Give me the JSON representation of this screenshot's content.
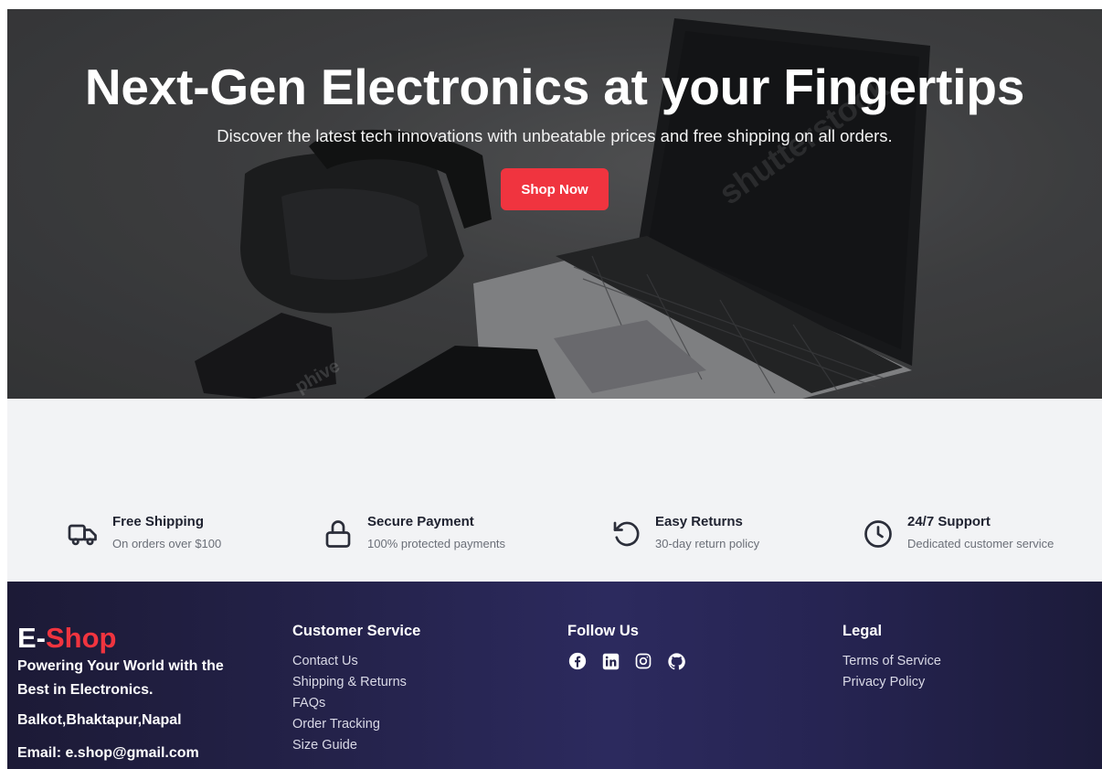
{
  "hero": {
    "title": "Next-Gen Electronics at your Fingertips",
    "subtitle": "Discover the latest tech innovations with unbeatable prices and free shipping on all orders.",
    "cta_label": "Shop Now",
    "watermarks": [
      "shutterstock",
      "phive"
    ]
  },
  "features": [
    {
      "icon": "truck-icon",
      "title": "Free Shipping",
      "desc": "On orders over $100"
    },
    {
      "icon": "lock-icon",
      "title": "Secure Payment",
      "desc": "100% protected payments"
    },
    {
      "icon": "rotate-ccw-icon",
      "title": "Easy Returns",
      "desc": "30-day return policy"
    },
    {
      "icon": "clock-icon",
      "title": "24/7 Support",
      "desc": "Dedicated customer service"
    }
  ],
  "footer": {
    "brand_prefix": "E-",
    "brand_suffix": "Shop",
    "tagline": "Powering Your World with the Best in Electronics.",
    "address": "Balkot,Bhaktapur,Napal",
    "email": "Email: e.shop@gmail.com",
    "customer_service": {
      "heading": "Customer Service",
      "links": [
        "Contact Us",
        "Shipping & Returns",
        "FAQs",
        "Order Tracking",
        "Size Guide"
      ]
    },
    "follow_us": {
      "heading": "Follow Us",
      "icons": [
        "facebook-icon",
        "linkedin-icon",
        "instagram-icon",
        "github-icon"
      ]
    },
    "legal": {
      "heading": "Legal",
      "links": [
        "Terms of Service",
        "Privacy Policy"
      ]
    }
  },
  "colors": {
    "accent": "#f0343f",
    "footer_bg": "#24224a",
    "features_bg": "#f2f3f5"
  }
}
